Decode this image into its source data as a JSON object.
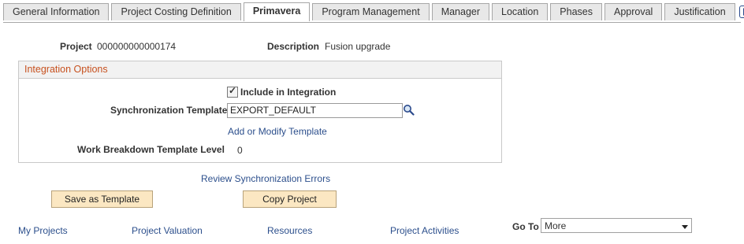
{
  "tabs": [
    "General Information",
    "Project Costing Definition",
    "Primavera",
    "Program Management",
    "Manager",
    "Location",
    "Phases",
    "Approval",
    "Justification"
  ],
  "active_tab": "Primavera",
  "header": {
    "project_label": "Project",
    "project_value": "000000000000174",
    "description_label": "Description",
    "description_value": "Fusion upgrade"
  },
  "integration": {
    "title": "Integration Options",
    "include_label": "Include in Integration",
    "include_checked": true,
    "sync_label": "Synchronization Template",
    "sync_value": "EXPORT_DEFAULT",
    "add_modify_link": "Add or Modify Template",
    "wbs_label": "Work Breakdown Template Level",
    "wbs_value": "0"
  },
  "review_link": "Review Synchronization Errors",
  "buttons": {
    "save_template": "Save as Template",
    "copy_project": "Copy Project"
  },
  "footer_links": [
    "My Projects",
    "Project Valuation",
    "Resources",
    "Project Activities"
  ],
  "goto": {
    "label": "Go To",
    "selected": "More"
  },
  "icons": {
    "next_tab": "next-tab-icon",
    "lookup": "search-icon",
    "dropdown": "chevron-down-icon"
  }
}
